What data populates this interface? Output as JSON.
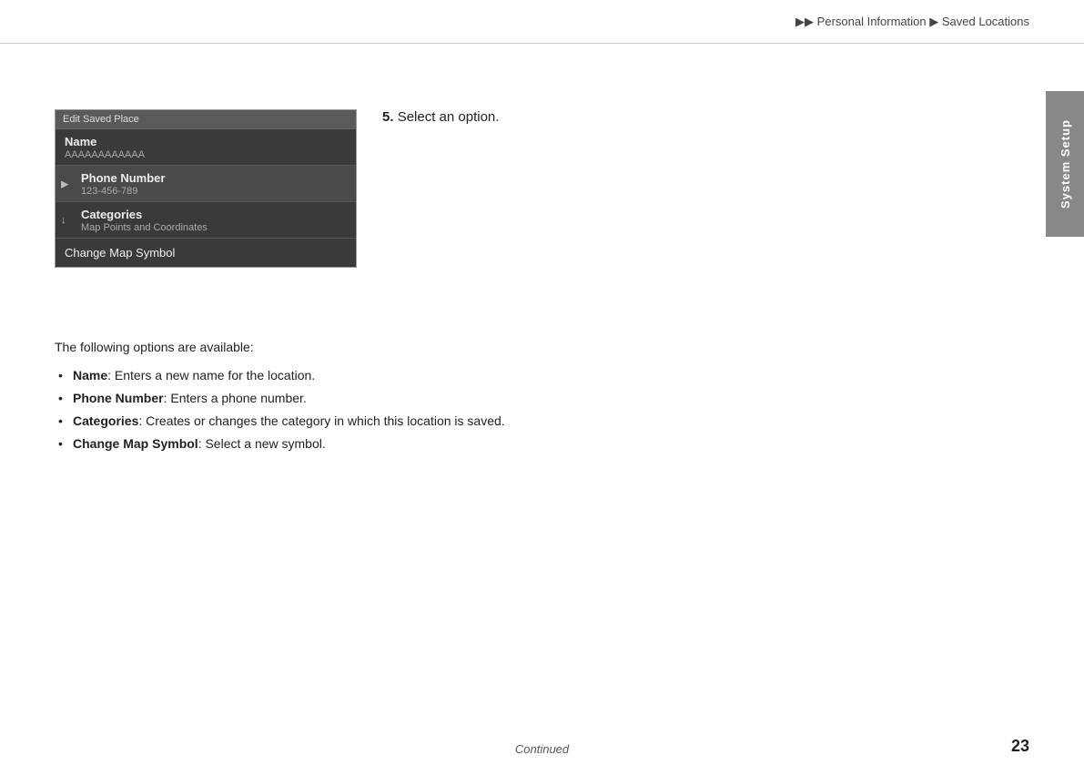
{
  "breadcrumb": {
    "arrow1": "▶▶",
    "section1": "Personal Information",
    "arrow2": "▶",
    "section2": "Saved Locations"
  },
  "side_tab": {
    "label": "System Setup"
  },
  "ui_panel": {
    "header": "Edit Saved Place",
    "rows": [
      {
        "label": "Name",
        "sub": "AAAAAAAAAAAA",
        "icon": null,
        "selected": false
      },
      {
        "label": "Phone Number",
        "sub": "123-456-789",
        "icon": "▶",
        "selected": true
      },
      {
        "label": "Categories",
        "sub": "Map Points and Coordinates",
        "icon": "↓",
        "selected": false
      }
    ],
    "bottom_row": "Change Map Symbol"
  },
  "step": {
    "number": "5.",
    "text": "Select an option."
  },
  "description": {
    "intro": "The following options are available:",
    "bullets": [
      {
        "term": "Name",
        "text": ": Enters a new name for the location."
      },
      {
        "term": "Phone Number",
        "text": ": Enters a phone number."
      },
      {
        "term": "Categories",
        "text": ": Creates or changes the category in which this location is saved."
      },
      {
        "term": "Change Map Symbol",
        "text": ": Select a new symbol."
      }
    ]
  },
  "footer": {
    "continued": "Continued",
    "page": "23"
  }
}
